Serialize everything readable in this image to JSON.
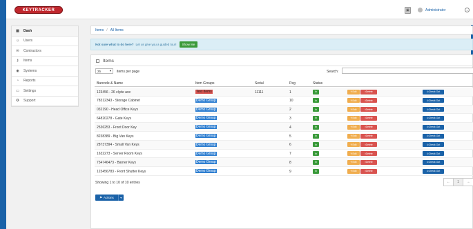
{
  "header": {
    "logo_text": "KEYTRACKER",
    "user_name": "Administrator"
  },
  "sidebar": {
    "items": [
      {
        "label": "Dash",
        "icon": "dashboard-icon"
      },
      {
        "label": "Users",
        "icon": "users-icon"
      },
      {
        "label": "Contractors",
        "icon": "contractors-icon"
      },
      {
        "label": "Items",
        "icon": "key-icon"
      },
      {
        "label": "Systems",
        "icon": "systems-icon"
      },
      {
        "label": "Reports",
        "icon": "reports-icon"
      },
      {
        "label": "Settings",
        "icon": "settings-icon"
      },
      {
        "label": "Support",
        "icon": "support-icon"
      }
    ]
  },
  "breadcrumb": {
    "items": [
      "Items",
      "All Items"
    ]
  },
  "info_bar": {
    "question": "Not sure what to do here?",
    "message": "Let us give you a guided tour!",
    "button": "Show Me"
  },
  "panel": {
    "title": "Items",
    "page_length": "25",
    "per_page_label": "items per page",
    "search_label": "Search:",
    "columns": [
      "Barcode & Name",
      "Item Groups",
      "Serial",
      "Peg",
      "Status"
    ],
    "rows": [
      {
        "name": "123456 - 26 clyde ave",
        "group": "Test Items",
        "group_color": "red",
        "serial": "11111",
        "peg": "1"
      },
      {
        "name": "78312343 - Storage Cabinet",
        "group": "Demo Group",
        "group_color": "blue",
        "serial": "",
        "peg": "10"
      },
      {
        "name": "032190 - Head Office Keys",
        "group": "Demo Group",
        "group_color": "blue",
        "serial": "",
        "peg": "2"
      },
      {
        "name": "64820278 - Gate Keys",
        "group": "Demo Group",
        "group_color": "blue",
        "serial": "",
        "peg": "3"
      },
      {
        "name": "2536253 - Front Door Key",
        "group": "Demo Group",
        "group_color": "blue",
        "serial": "",
        "peg": "4"
      },
      {
        "name": "8238389 - Big Van Keys",
        "group": "Demo Group",
        "group_color": "blue",
        "serial": "",
        "peg": "5"
      },
      {
        "name": "28737394 - Small Van Keys",
        "group": "Demo Group",
        "group_color": "blue",
        "serial": "",
        "peg": "6"
      },
      {
        "name": "1632273 - Server Room Keys",
        "group": "Demo Group",
        "group_color": "blue",
        "serial": "",
        "peg": "7"
      },
      {
        "name": "734746473 - Barner Keys",
        "group": "Demo Group",
        "group_color": "blue",
        "serial": "",
        "peg": "8"
      },
      {
        "name": "123456783 - Front Shutter Keys",
        "group": "Demo Group",
        "group_color": "blue",
        "serial": "",
        "peg": "9"
      }
    ],
    "status_label": "In",
    "edit_label": "Edit",
    "delete_label": "Delete",
    "checkout_label": "Check Out",
    "showing_text": "Showing 1 to 10 of 10 entries",
    "pager": [
      "←",
      "1",
      "→"
    ],
    "actions_label": "Actions"
  }
}
